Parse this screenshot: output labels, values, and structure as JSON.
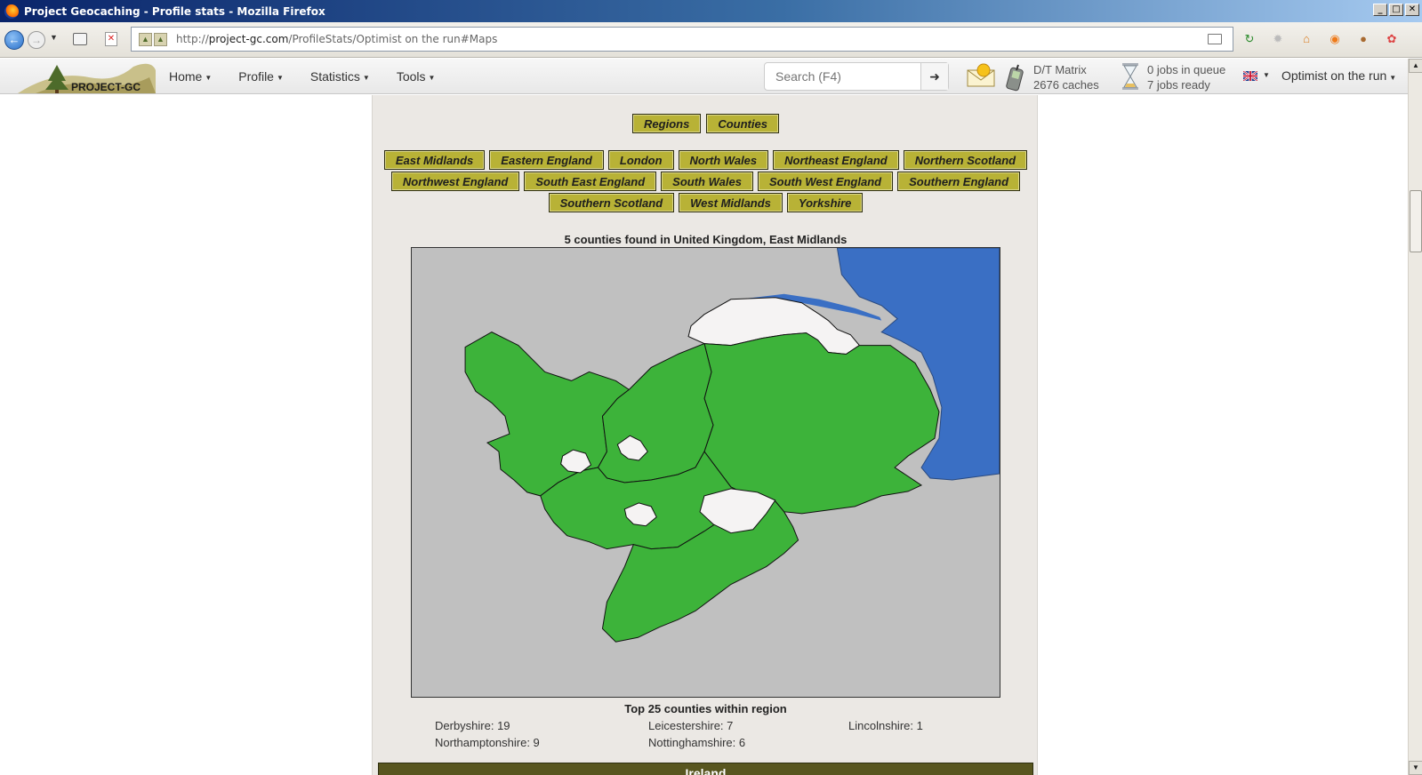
{
  "window": {
    "title": "Project Geocaching - Profile stats - Mozilla Firefox",
    "controls": [
      "_",
      "□",
      "✕"
    ]
  },
  "browser": {
    "url_host": "project-gc.com",
    "url_rest": "/ProfileStats/Optimist on the run#Maps",
    "url_scheme": "http://"
  },
  "site": {
    "logo_text": "PROJECT-GC",
    "menu": [
      {
        "label": "Home"
      },
      {
        "label": "Profile"
      },
      {
        "label": "Statistics"
      },
      {
        "label": "Tools"
      }
    ],
    "search_placeholder": "Search (F4)",
    "dt_matrix": {
      "line1": "D/T Matrix",
      "line2": "2676 caches"
    },
    "jobs": {
      "line1": "0 jobs in queue",
      "line2": "7 jobs ready"
    },
    "user": "Optimist on the run"
  },
  "tabs": [
    {
      "label": "Regions"
    },
    {
      "label": "Counties"
    }
  ],
  "regions": [
    [
      "East Midlands",
      "Eastern England",
      "London",
      "North Wales",
      "Northeast England",
      "Northern Scotland"
    ],
    [
      "Northwest England",
      "South East England",
      "South Wales",
      "South West England",
      "Southern England"
    ],
    [
      "Southern Scotland",
      "West Midlands",
      "Yorkshire"
    ]
  ],
  "map": {
    "caption": "5 counties found in United Kingdom, East Midlands",
    "colors": {
      "visited": "#3db33a",
      "unvisited": "#f5f3f3",
      "sea": "#3a6fc4",
      "land_outside": "#c0c0c0"
    }
  },
  "top_counties": {
    "caption": "Top 25 counties within region",
    "items": [
      "Derbyshire: 19",
      "Leicestershire: 7",
      "Lincolnshire: 1",
      "Northamptonshire: 9",
      "Nottinghamshire: 6"
    ]
  },
  "next_section": "Ireland"
}
